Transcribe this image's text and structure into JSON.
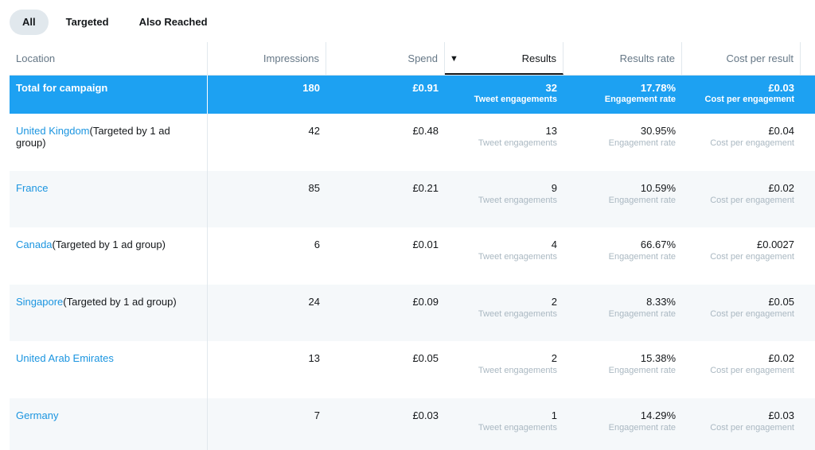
{
  "tabs": [
    {
      "label": "All",
      "active": true
    },
    {
      "label": "Targeted",
      "active": false
    },
    {
      "label": "Also Reached",
      "active": false
    }
  ],
  "table": {
    "columns": {
      "location": "Location",
      "impressions": "Impressions",
      "spend": "Spend",
      "results": "Results",
      "results_rate": "Results rate",
      "cost_per_result": "Cost per result"
    },
    "sort": {
      "column": "results",
      "direction": "descending",
      "icon": "caret-down-icon"
    },
    "total": {
      "location": "Total for campaign",
      "impressions": "180",
      "spend": "£0.91",
      "results": "32",
      "results_sub": "Tweet engagements",
      "results_rate": "17.78%",
      "results_rate_sub": "Engagement rate",
      "cost_per_result": "£0.03",
      "cost_per_result_sub": "Cost per engagement"
    },
    "rows": [
      {
        "location": "United Kingdom",
        "note": "(Targeted by 1 ad group)",
        "impressions": "42",
        "spend": "£0.48",
        "results": "13",
        "results_sub": "Tweet engagements",
        "results_rate": "30.95%",
        "results_rate_sub": "Engagement rate",
        "cost_per_result": "£0.04",
        "cost_per_result_sub": "Cost per engagement"
      },
      {
        "location": "France",
        "note": "",
        "impressions": "85",
        "spend": "£0.21",
        "results": "9",
        "results_sub": "Tweet engagements",
        "results_rate": "10.59%",
        "results_rate_sub": "Engagement rate",
        "cost_per_result": "£0.02",
        "cost_per_result_sub": "Cost per engagement"
      },
      {
        "location": "Canada",
        "note": "(Targeted by 1 ad group)",
        "impressions": "6",
        "spend": "£0.01",
        "results": "4",
        "results_sub": "Tweet engagements",
        "results_rate": "66.67%",
        "results_rate_sub": "Engagement rate",
        "cost_per_result": "£0.0027",
        "cost_per_result_sub": "Cost per engagement"
      },
      {
        "location": "Singapore",
        "note": "(Targeted by 1 ad group)",
        "impressions": "24",
        "spend": "£0.09",
        "results": "2",
        "results_sub": "Tweet engagements",
        "results_rate": "8.33%",
        "results_rate_sub": "Engagement rate",
        "cost_per_result": "£0.05",
        "cost_per_result_sub": "Cost per engagement"
      },
      {
        "location": "United Arab Emirates",
        "note": "",
        "impressions": "13",
        "spend": "£0.05",
        "results": "2",
        "results_sub": "Tweet engagements",
        "results_rate": "15.38%",
        "results_rate_sub": "Engagement rate",
        "cost_per_result": "£0.02",
        "cost_per_result_sub": "Cost per engagement"
      },
      {
        "location": "Germany",
        "note": "",
        "impressions": "7",
        "spend": "£0.03",
        "results": "1",
        "results_sub": "Tweet engagements",
        "results_rate": "14.29%",
        "results_rate_sub": "Engagement rate",
        "cost_per_result": "£0.03",
        "cost_per_result_sub": "Cost per engagement"
      }
    ]
  },
  "colors": {
    "accent": "#1da1f2",
    "link": "#1b95e0",
    "muted": "#657786",
    "subtext": "#aab8c2",
    "alt_row": "#f5f8fa",
    "tab_active_bg": "#e1e8ed"
  }
}
